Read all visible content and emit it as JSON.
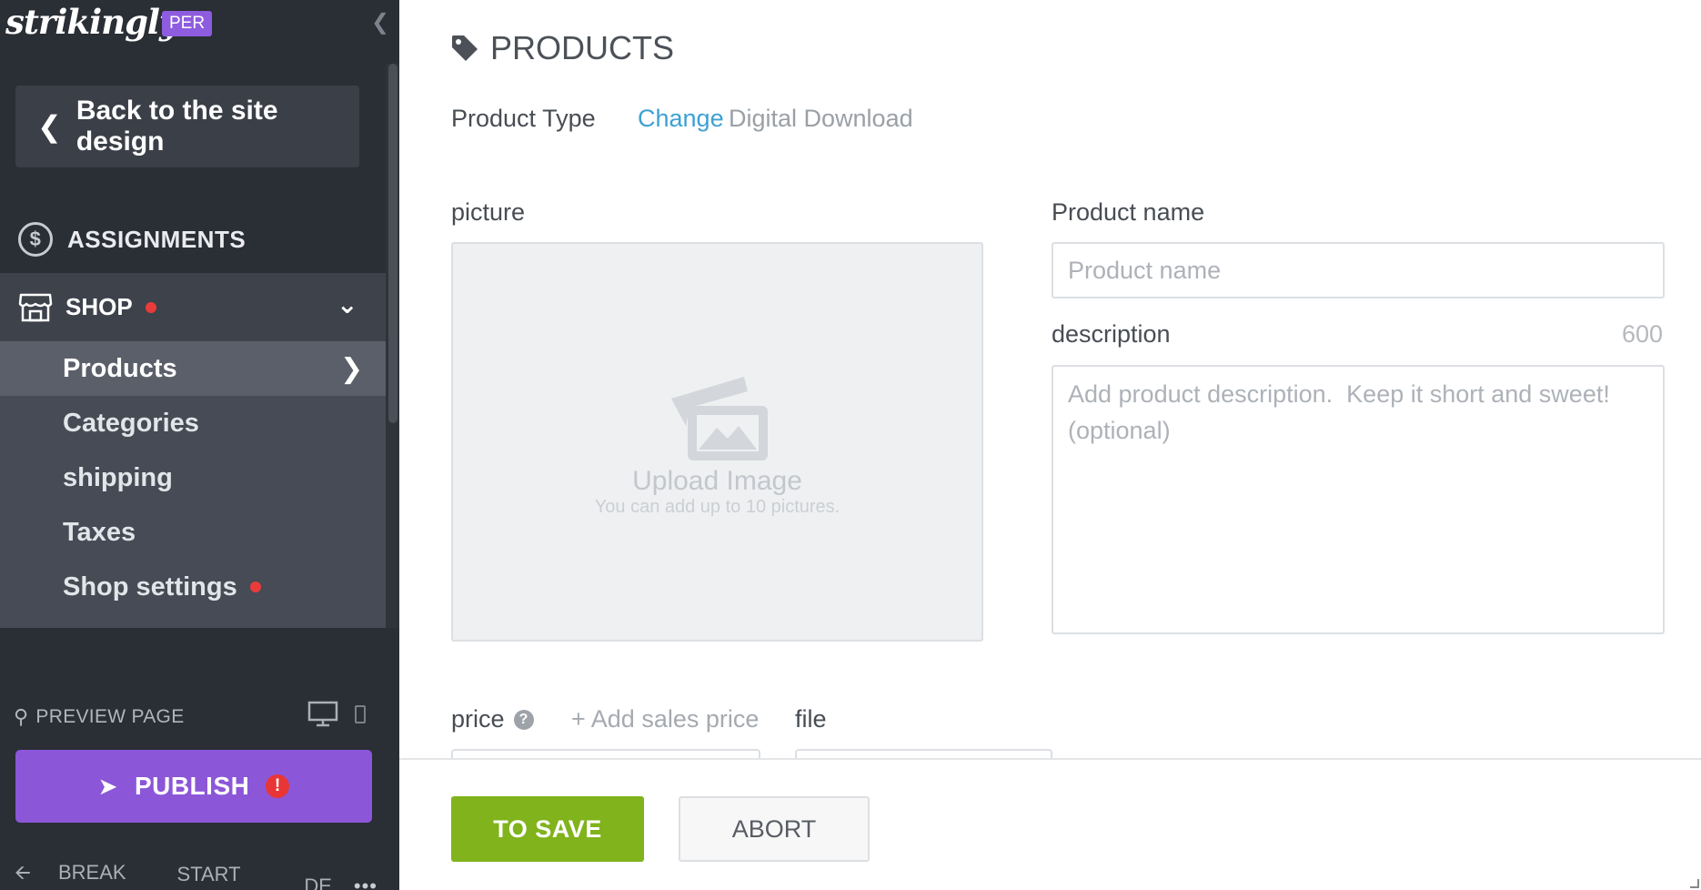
{
  "sidebar": {
    "logo": "strikingly",
    "plan_badge": "PER",
    "back_label": "Back to the site design",
    "assignments_label": "ASSIGNMENTS",
    "shop_label": "SHOP",
    "submenu": [
      {
        "label": "Products",
        "active": true
      },
      {
        "label": "Categories"
      },
      {
        "label": "shipping"
      },
      {
        "label": "Taxes"
      },
      {
        "label": "Shop settings",
        "has_dot": true
      }
    ],
    "preview_label": "PREVIEW PAGE",
    "publish_label": "PUBLISH",
    "publish_alert": "!",
    "footer": {
      "break_up": "BREAK UP",
      "start_tour": "START TOUR",
      "language": "DE",
      "more": "•••"
    },
    "icons": {
      "collapse": "chevron-left-icon",
      "back": "chevron-left-icon",
      "assignments": "dollar-circle-icon",
      "shop": "store-icon",
      "preview": "search-icon",
      "desktop": "monitor-icon",
      "mobile": "phone-icon",
      "publish": "rocket-icon",
      "break_up": "arrow-left-icon"
    },
    "colors": {
      "background": "#2a2e35",
      "publish": "#8b57d8",
      "badge": "#8e5cde",
      "alert": "#e83636"
    }
  },
  "main": {
    "title": "PRODUCTS",
    "product_type_label": "Product Type",
    "product_type_change": "Change",
    "product_type_value": "Digital Download",
    "picture_label": "picture",
    "upload_title": "Upload Image",
    "upload_sub": "You can add up to 10 pictures.",
    "product_name_label": "Product name",
    "product_name_placeholder": "Product name",
    "description_label": "description",
    "description_count": "600",
    "description_placeholder": "Add product description.  Keep it short and sweet! (optional)",
    "price_label": "price",
    "price_help": "?",
    "add_sales_label": "+ Add sales price",
    "file_label": "file",
    "save_label": "TO SAVE",
    "abort_label": "ABORT",
    "colors": {
      "link": "#3da1d4",
      "save": "#80b31c"
    }
  }
}
